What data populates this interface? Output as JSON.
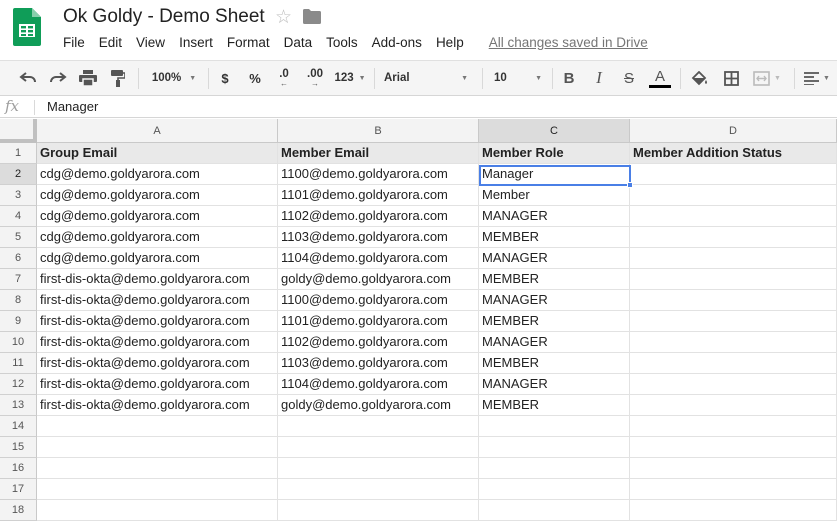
{
  "app": {
    "title": "Ok Goldy - Demo Sheet",
    "saved_status": "All changes saved in Drive"
  },
  "menu": [
    "File",
    "Edit",
    "View",
    "Insert",
    "Format",
    "Data",
    "Tools",
    "Add-ons",
    "Help"
  ],
  "toolbar": {
    "zoom": "100%",
    "currency": "$",
    "percent": "%",
    "decrease_decimals": ".0",
    "increase_decimals": ".00",
    "more_formats": "123",
    "font": "Arial",
    "font_size": "10",
    "icons": [
      "undo-icon",
      "redo-icon",
      "print-icon",
      "paint-format-icon",
      "bold-icon",
      "italic-icon",
      "strikethrough-icon",
      "text-color-icon",
      "fill-color-icon",
      "borders-icon",
      "merge-cells-icon",
      "align-icon"
    ],
    "colors": {
      "accent": "#4a7fe6",
      "sheets_green": "#0f9d58",
      "text_color_bar": "#000000"
    }
  },
  "formula_bar": {
    "fx_label": "fx",
    "value": "Manager"
  },
  "grid": {
    "columns": [
      "A",
      "B",
      "C",
      "D"
    ],
    "selected_column": "C",
    "selected_row": "2",
    "rows": [
      "1",
      "2",
      "3",
      "4",
      "5",
      "6",
      "7",
      "8",
      "9",
      "10",
      "11",
      "12",
      "13",
      "14",
      "15",
      "16",
      "17",
      "18"
    ],
    "header_row": [
      "Group Email",
      "Member Email",
      "Member Role",
      "Member Addition Status"
    ],
    "data": [
      [
        "cdg@demo.goldyarora.com",
        "1100@demo.goldyarora.com",
        "Manager",
        ""
      ],
      [
        "cdg@demo.goldyarora.com",
        "1101@demo.goldyarora.com",
        "Member",
        ""
      ],
      [
        "cdg@demo.goldyarora.com",
        "1102@demo.goldyarora.com",
        "MANAGER",
        ""
      ],
      [
        "cdg@demo.goldyarora.com",
        "1103@demo.goldyarora.com",
        "MEMBER",
        ""
      ],
      [
        "cdg@demo.goldyarora.com",
        "1104@demo.goldyarora.com",
        "MANAGER",
        ""
      ],
      [
        "first-dis-okta@demo.goldyarora.com",
        "goldy@demo.goldyarora.com",
        "MEMBER",
        ""
      ],
      [
        "first-dis-okta@demo.goldyarora.com",
        "1100@demo.goldyarora.com",
        "MANAGER",
        ""
      ],
      [
        "first-dis-okta@demo.goldyarora.com",
        "1101@demo.goldyarora.com",
        "MEMBER",
        ""
      ],
      [
        "first-dis-okta@demo.goldyarora.com",
        "1102@demo.goldyarora.com",
        "MANAGER",
        ""
      ],
      [
        "first-dis-okta@demo.goldyarora.com",
        "1103@demo.goldyarora.com",
        "MEMBER",
        ""
      ],
      [
        "first-dis-okta@demo.goldyarora.com",
        "1104@demo.goldyarora.com",
        "MANAGER",
        ""
      ],
      [
        "first-dis-okta@demo.goldyarora.com",
        "goldy@demo.goldyarora.com",
        "MEMBER",
        ""
      ]
    ]
  }
}
